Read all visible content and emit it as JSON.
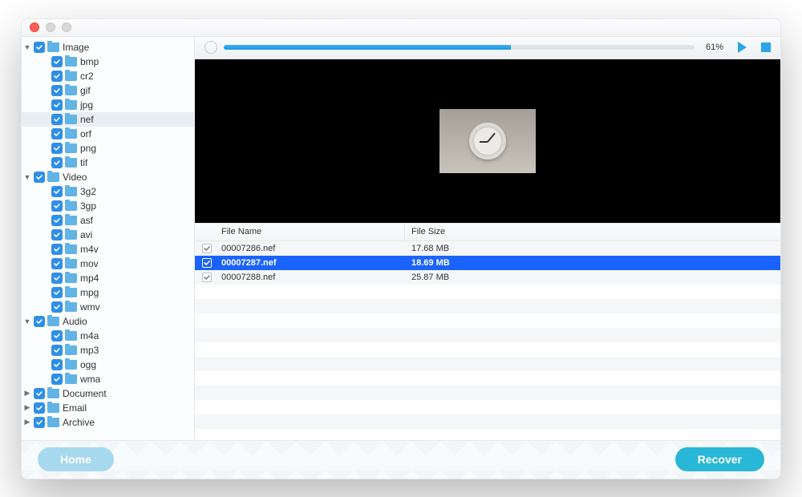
{
  "progress": {
    "percent_value": 61,
    "percent_label": "61%"
  },
  "file_table": {
    "columns": {
      "name": "File Name",
      "size": "File Size"
    },
    "rows": [
      {
        "checked": true,
        "name": "00007286.nef",
        "size": "17.68 MB",
        "selected": false
      },
      {
        "checked": true,
        "name": "00007287.nef",
        "size": "18.69 MB",
        "selected": true
      },
      {
        "checked": true,
        "name": "00007288.nef",
        "size": "25.87 MB",
        "selected": false
      }
    ],
    "blank_rows": 12
  },
  "buttons": {
    "home": "Home",
    "recover": "Recover"
  },
  "tree": [
    {
      "level": 0,
      "expanded": true,
      "checked": true,
      "label": "Image",
      "selected": false
    },
    {
      "level": 1,
      "expanded": null,
      "checked": true,
      "label": "bmp",
      "selected": false
    },
    {
      "level": 1,
      "expanded": null,
      "checked": true,
      "label": "cr2",
      "selected": false
    },
    {
      "level": 1,
      "expanded": null,
      "checked": true,
      "label": "gif",
      "selected": false
    },
    {
      "level": 1,
      "expanded": null,
      "checked": true,
      "label": "jpg",
      "selected": false
    },
    {
      "level": 1,
      "expanded": null,
      "checked": true,
      "label": "nef",
      "selected": true
    },
    {
      "level": 1,
      "expanded": null,
      "checked": true,
      "label": "orf",
      "selected": false
    },
    {
      "level": 1,
      "expanded": null,
      "checked": true,
      "label": "png",
      "selected": false
    },
    {
      "level": 1,
      "expanded": null,
      "checked": true,
      "label": "tif",
      "selected": false
    },
    {
      "level": 0,
      "expanded": true,
      "checked": true,
      "label": "Video",
      "selected": false
    },
    {
      "level": 1,
      "expanded": null,
      "checked": true,
      "label": "3g2",
      "selected": false
    },
    {
      "level": 1,
      "expanded": null,
      "checked": true,
      "label": "3gp",
      "selected": false
    },
    {
      "level": 1,
      "expanded": null,
      "checked": true,
      "label": "asf",
      "selected": false
    },
    {
      "level": 1,
      "expanded": null,
      "checked": true,
      "label": "avi",
      "selected": false
    },
    {
      "level": 1,
      "expanded": null,
      "checked": true,
      "label": "m4v",
      "selected": false
    },
    {
      "level": 1,
      "expanded": null,
      "checked": true,
      "label": "mov",
      "selected": false
    },
    {
      "level": 1,
      "expanded": null,
      "checked": true,
      "label": "mp4",
      "selected": false
    },
    {
      "level": 1,
      "expanded": null,
      "checked": true,
      "label": "mpg",
      "selected": false
    },
    {
      "level": 1,
      "expanded": null,
      "checked": true,
      "label": "wmv",
      "selected": false
    },
    {
      "level": 0,
      "expanded": true,
      "checked": true,
      "label": "Audio",
      "selected": false
    },
    {
      "level": 1,
      "expanded": null,
      "checked": true,
      "label": "m4a",
      "selected": false
    },
    {
      "level": 1,
      "expanded": null,
      "checked": true,
      "label": "mp3",
      "selected": false
    },
    {
      "level": 1,
      "expanded": null,
      "checked": true,
      "label": "ogg",
      "selected": false
    },
    {
      "level": 1,
      "expanded": null,
      "checked": true,
      "label": "wma",
      "selected": false
    },
    {
      "level": 0,
      "expanded": false,
      "checked": true,
      "label": "Document",
      "selected": false
    },
    {
      "level": 0,
      "expanded": false,
      "checked": true,
      "label": "Email",
      "selected": false
    },
    {
      "level": 0,
      "expanded": false,
      "checked": true,
      "label": "Archive",
      "selected": false
    }
  ]
}
